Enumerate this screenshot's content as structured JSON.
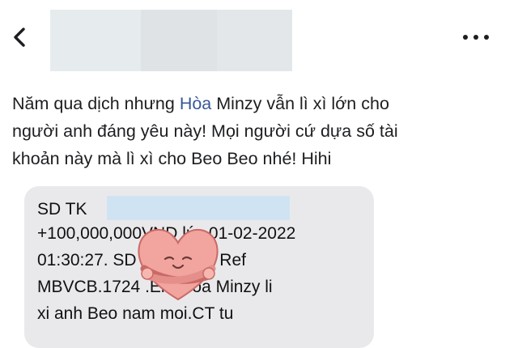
{
  "post": {
    "line1_pre": "Năm qua dịch nhưng ",
    "line1_highlight": "Hòa",
    "line1_post": " Minzy vẫn lì xì lớn cho",
    "line2": "người anh đáng yêu này! Mọi người cứ dựa số tài",
    "line3": "khoản này mà lì xì cho Beo Beo nhé! Hihi"
  },
  "sms": {
    "line1": "SD TK",
    "line2": "+100,000,000VND lúc 01-02-2022",
    "line3": "01:30:27. SD              .823VND. Ref",
    "line4": "MBVCB.1724         .Em Hoa Minzy li",
    "line5": "xi anh Beo nam moi.CT tu"
  },
  "colors": {
    "link": "#385898",
    "bubble": "#e9e9eb",
    "redaction": "#cfe3f3",
    "sticker": "#f2a49f"
  },
  "icons": {
    "back": "chevron-left-icon",
    "more": "more-horizontal-icon",
    "sticker": "hug-heart-sticker"
  }
}
